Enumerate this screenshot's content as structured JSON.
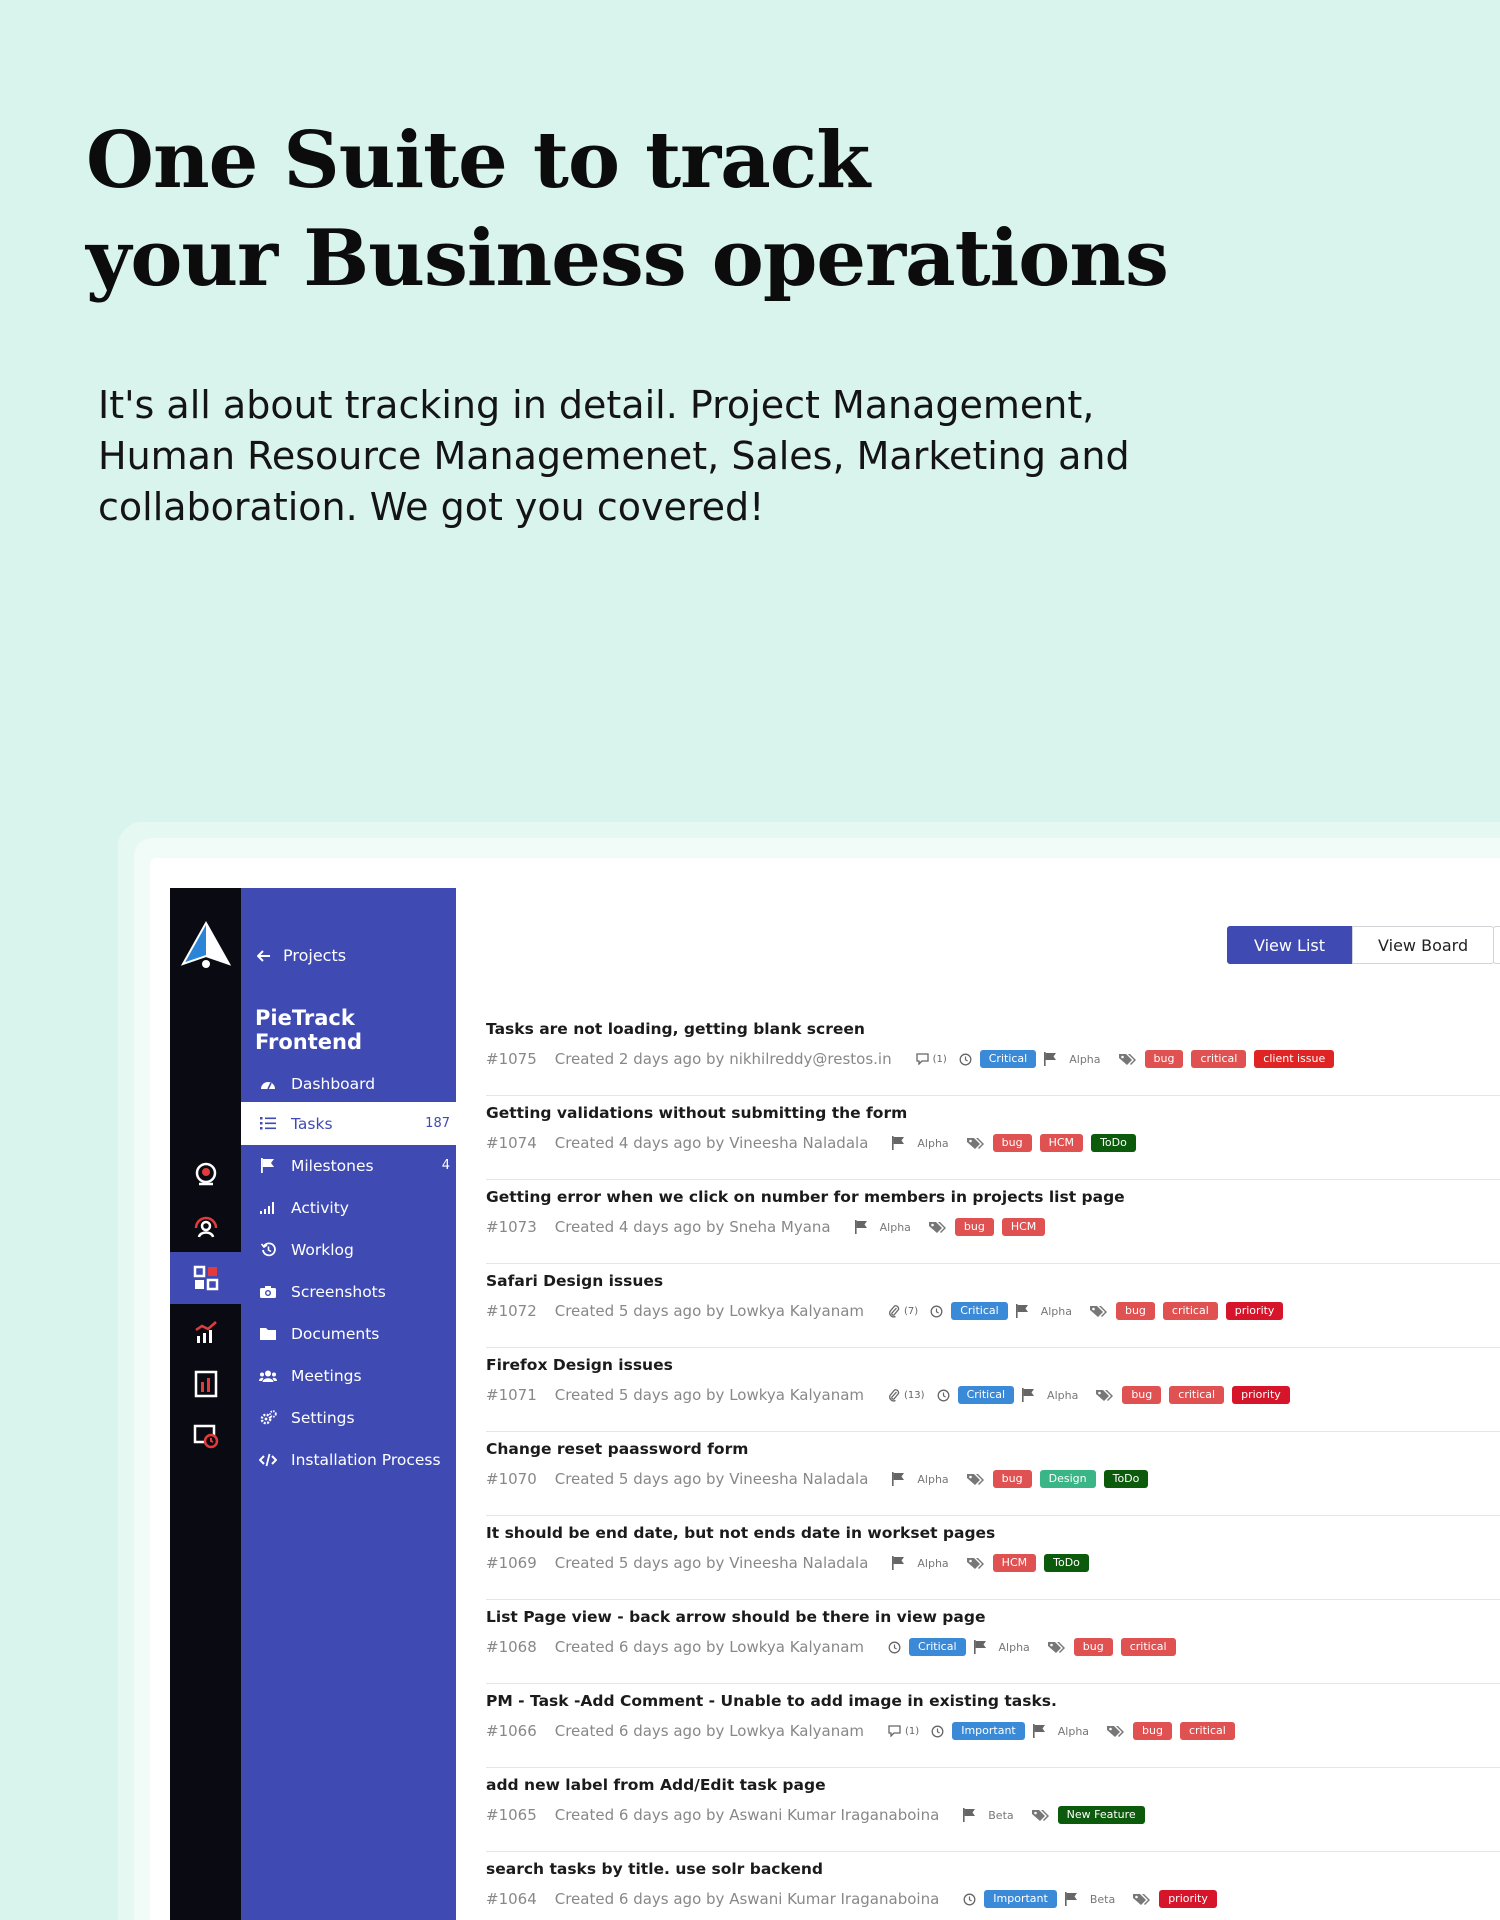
{
  "hero": {
    "title_line1": "One Suite to track",
    "title_line2": "your Business operations",
    "subtitle": "It's all about tracking in detail. Project Management, Human Resource Managemenet, Sales, Marketing and collaboration. We got you covered!"
  },
  "sidebar": {
    "back_label": "Projects",
    "project_title": "PieTrack Frontend",
    "items": [
      {
        "label": "Dashboard",
        "icon": "dashboard-icon",
        "count": ""
      },
      {
        "label": "Tasks",
        "icon": "list-icon",
        "count": "187",
        "active": true
      },
      {
        "label": "Milestones",
        "icon": "flag-icon",
        "count": "4"
      },
      {
        "label": "Activity",
        "icon": "activity-icon",
        "count": ""
      },
      {
        "label": "Worklog",
        "icon": "history-icon",
        "count": ""
      },
      {
        "label": "Screenshots",
        "icon": "camera-icon",
        "count": ""
      },
      {
        "label": "Documents",
        "icon": "folder-icon",
        "count": ""
      },
      {
        "label": "Meetings",
        "icon": "users-icon",
        "count": ""
      },
      {
        "label": "Settings",
        "icon": "cogs-icon",
        "count": ""
      },
      {
        "label": "Installation Process",
        "icon": "code-icon",
        "count": ""
      }
    ]
  },
  "rail": {
    "icons": [
      "recruit-icon",
      "user-icon",
      "apps-icon",
      "analytics-icon",
      "report-icon",
      "time-icon"
    ],
    "active_index": 2
  },
  "toolbar": {
    "view_list": "View List",
    "view_board": "View Board"
  },
  "colors": {
    "primary": "#3f4bb2",
    "critical": "#3b8ad8",
    "important": "#3b8ad8",
    "bug": "#e05252",
    "critical_tag": "#e05252",
    "client_issue": "#e02424",
    "priority": "#d6152b",
    "hcm": "#e05252",
    "todo": "#0c5a0c",
    "design": "#3ab585",
    "new_feature": "#0c5a0c"
  },
  "tasks": [
    {
      "title": "Tasks are not loading, getting blank screen",
      "id": "#1075",
      "created": "Created 2 days ago by nikhilreddy@restos.in",
      "comments": "(1)",
      "attachments": "",
      "clock": true,
      "severity": "Critical",
      "milestone": "Alpha",
      "tags": [
        {
          "t": "bug",
          "c": "#e05252"
        },
        {
          "t": "critical",
          "c": "#e05252"
        },
        {
          "t": "client issue",
          "c": "#e02424"
        }
      ]
    },
    {
      "title": "Getting validations without submitting the form",
      "id": "#1074",
      "created": "Created 4 days ago by Vineesha Naladala",
      "comments": "",
      "attachments": "",
      "clock": false,
      "severity": "",
      "milestone": "Alpha",
      "tags": [
        {
          "t": "bug",
          "c": "#e05252"
        },
        {
          "t": "HCM",
          "c": "#e05252"
        },
        {
          "t": "ToDo",
          "c": "#0c5a0c"
        }
      ]
    },
    {
      "title": "Getting error when we click on number for members in projects list page",
      "id": "#1073",
      "created": "Created 4 days ago by Sneha Myana",
      "comments": "",
      "attachments": "",
      "clock": false,
      "severity": "",
      "milestone": "Alpha",
      "tags": [
        {
          "t": "bug",
          "c": "#e05252"
        },
        {
          "t": "HCM",
          "c": "#e05252"
        }
      ]
    },
    {
      "title": "Safari Design issues",
      "id": "#1072",
      "created": "Created 5 days ago by Lowkya Kalyanam",
      "comments": "",
      "attachments": "(7)",
      "clock": true,
      "severity": "Critical",
      "milestone": "Alpha",
      "tags": [
        {
          "t": "bug",
          "c": "#e05252"
        },
        {
          "t": "critical",
          "c": "#e05252"
        },
        {
          "t": "priority",
          "c": "#d6152b"
        }
      ]
    },
    {
      "title": "Firefox Design issues",
      "id": "#1071",
      "created": "Created 5 days ago by Lowkya Kalyanam",
      "comments": "",
      "attachments": "(13)",
      "clock": true,
      "severity": "Critical",
      "milestone": "Alpha",
      "tags": [
        {
          "t": "bug",
          "c": "#e05252"
        },
        {
          "t": "critical",
          "c": "#e05252"
        },
        {
          "t": "priority",
          "c": "#d6152b"
        }
      ]
    },
    {
      "title": "Change reset paassword form",
      "id": "#1070",
      "created": "Created 5 days ago by Vineesha Naladala",
      "comments": "",
      "attachments": "",
      "clock": false,
      "severity": "",
      "milestone": "Alpha",
      "tags": [
        {
          "t": "bug",
          "c": "#e05252"
        },
        {
          "t": "Design",
          "c": "#3ab585"
        },
        {
          "t": "ToDo",
          "c": "#0c5a0c"
        }
      ]
    },
    {
      "title": "It should be end date, but not ends date in workset pages",
      "id": "#1069",
      "created": "Created 5 days ago by Vineesha Naladala",
      "comments": "",
      "attachments": "",
      "clock": false,
      "severity": "",
      "milestone": "Alpha",
      "tags": [
        {
          "t": "HCM",
          "c": "#e05252"
        },
        {
          "t": "ToDo",
          "c": "#0c5a0c"
        }
      ]
    },
    {
      "title": "List Page view - back arrow should be there in view page",
      "id": "#1068",
      "created": "Created 6 days ago by Lowkya Kalyanam",
      "comments": "",
      "attachments": "",
      "clock": true,
      "severity": "Critical",
      "milestone": "Alpha",
      "tags": [
        {
          "t": "bug",
          "c": "#e05252"
        },
        {
          "t": "critical",
          "c": "#e05252"
        }
      ]
    },
    {
      "title": "PM - Task -Add Comment - Unable to add image in existing tasks.",
      "id": "#1066",
      "created": "Created 6 days ago by Lowkya Kalyanam",
      "comments": "(1)",
      "attachments": "",
      "clock": true,
      "severity": "Important",
      "milestone": "Alpha",
      "tags": [
        {
          "t": "bug",
          "c": "#e05252"
        },
        {
          "t": "critical",
          "c": "#e05252"
        }
      ]
    },
    {
      "title": "add new label from Add/Edit task page",
      "id": "#1065",
      "created": "Created 6 days ago by Aswani Kumar Iraganaboina",
      "comments": "",
      "attachments": "",
      "clock": false,
      "severity": "",
      "milestone": "Beta",
      "tags": [
        {
          "t": "New Feature",
          "c": "#0c5a0c"
        }
      ]
    },
    {
      "title": "search tasks by title. use solr backend",
      "id": "#1064",
      "created": "Created 6 days ago by Aswani Kumar Iraganaboina",
      "comments": "",
      "attachments": "",
      "clock": true,
      "severity": "Important",
      "milestone": "Beta",
      "tags": [
        {
          "t": "priority",
          "c": "#d6152b"
        }
      ]
    }
  ]
}
